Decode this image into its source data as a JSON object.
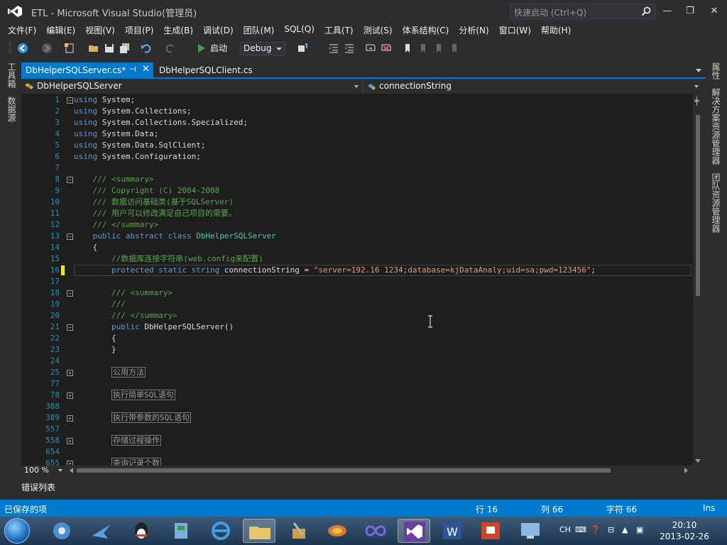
{
  "window": {
    "title": "ETL - Microsoft Visual Studio(管理员)",
    "quick_launch_placeholder": "快速启动 (Ctrl+Q)",
    "minimize": "—",
    "restore": "❐",
    "close": "✕"
  },
  "menu": [
    "文件(F)",
    "编辑(E)",
    "视图(V)",
    "项目(P)",
    "生成(B)",
    "调试(D)",
    "团队(M)",
    "SQL(Q)",
    "工具(T)",
    "测试(S)",
    "体系结构(C)",
    "分析(N)",
    "窗口(W)",
    "帮助(H)"
  ],
  "toolbar": {
    "start_label": "启动",
    "config_value": "Debug"
  },
  "left_tabs": [
    "工具箱",
    "数据源"
  ],
  "right_tabs": [
    "属性",
    "解决方案资源管理器",
    "团队资源管理器"
  ],
  "tabs": [
    {
      "label": "DbHelperSQLServer.cs*",
      "active": true
    },
    {
      "label": "DbHelperSQLClient.cs",
      "active": false
    }
  ],
  "nav": {
    "type": "DbHelperSQLServer",
    "member": "connectionString"
  },
  "code": {
    "l1": {
      "n": "1",
      "kw": "using",
      "rest": " System;"
    },
    "l2": {
      "n": "2",
      "kw": "using",
      "rest": " System.Collections;"
    },
    "l3": {
      "n": "3",
      "kw": "using",
      "rest": " System.Collections.Specialized;"
    },
    "l4": {
      "n": "4",
      "kw": "using",
      "rest": " System.Data;"
    },
    "l5": {
      "n": "5",
      "kw": "using",
      "rest": " System.Data.SqlClient;"
    },
    "l6": {
      "n": "6",
      "kw": "using",
      "rest": " System.Configuration;"
    },
    "l7": {
      "n": "7"
    },
    "l8": {
      "n": "8",
      "text": "    /// <summary>"
    },
    "l9": {
      "n": "9",
      "text": "    /// Copyright (C) 2004-2008"
    },
    "l10": {
      "n": "10",
      "text": "    /// 数据访问基础类(基于SQLServer)"
    },
    "l11": {
      "n": "11",
      "text": "    /// 用户可以修改满足自己项目的需要。"
    },
    "l12": {
      "n": "12",
      "text": "    /// </summary>"
    },
    "l13": {
      "n": "13",
      "kw": "    public abstract class ",
      "type": "DbHelperSQLServer"
    },
    "l14": {
      "n": "14",
      "text": "    {"
    },
    "l15": {
      "n": "15",
      "text": "        //数据库连接字符串(web.config来配置)"
    },
    "l16": {
      "n": "16",
      "kw": "        protected static string ",
      "name": "connectionString = ",
      "str": "\"server=192.16 1234;database=kjDataAnaly;uid=sa;pwd=123456\"",
      "end": ";"
    },
    "l17": {
      "n": "17"
    },
    "l18": {
      "n": "18",
      "text": "        /// <summary>"
    },
    "l19": {
      "n": "19",
      "text": "        ///"
    },
    "l20": {
      "n": "20",
      "text": "        /// </summary>"
    },
    "l21": {
      "n": "21",
      "kw": "        public ",
      "rest": "DbHelperSQLServer()"
    },
    "l22": {
      "n": "22",
      "text": "        {"
    },
    "l23": {
      "n": "23",
      "text": "        }"
    },
    "l24": {
      "n": "24"
    },
    "l25": {
      "n": "25",
      "region": "公用方法"
    },
    "l77": {
      "n": "77"
    },
    "l78": {
      "n": "78",
      "region": "执行简单SQL语句"
    },
    "l388": {
      "n": "388"
    },
    "l389": {
      "n": "389",
      "region": "执行带参数的SQL语句"
    },
    "l557": {
      "n": "557"
    },
    "l558": {
      "n": "558",
      "region": "存储过程操作"
    },
    "l654": {
      "n": "654"
    },
    "l655": {
      "n": "655",
      "region": "查询记录个数"
    }
  },
  "zoom": "100 %",
  "error_list": "错误列表",
  "status": {
    "message": "已保存的项",
    "row": "行 16",
    "col": "列 66",
    "char": "字符 66",
    "mode": "Ins"
  },
  "tray": {
    "lang": "CH",
    "time": "20:10",
    "date": "2013-02-26"
  },
  "colors": {
    "accent": "#007acc",
    "editor_bg": "#1e1e1e",
    "keyword": "#569cd6",
    "comment": "#57a64a",
    "string": "#d69d85",
    "type": "#4ec9b0"
  },
  "icons": [
    "vs-logo-icon",
    "search-icon",
    "back-icon",
    "forward-icon",
    "new-project-icon",
    "open-icon",
    "save-icon",
    "save-all-icon",
    "undo-icon",
    "redo-icon",
    "play-icon",
    "bookmark-icon"
  ]
}
